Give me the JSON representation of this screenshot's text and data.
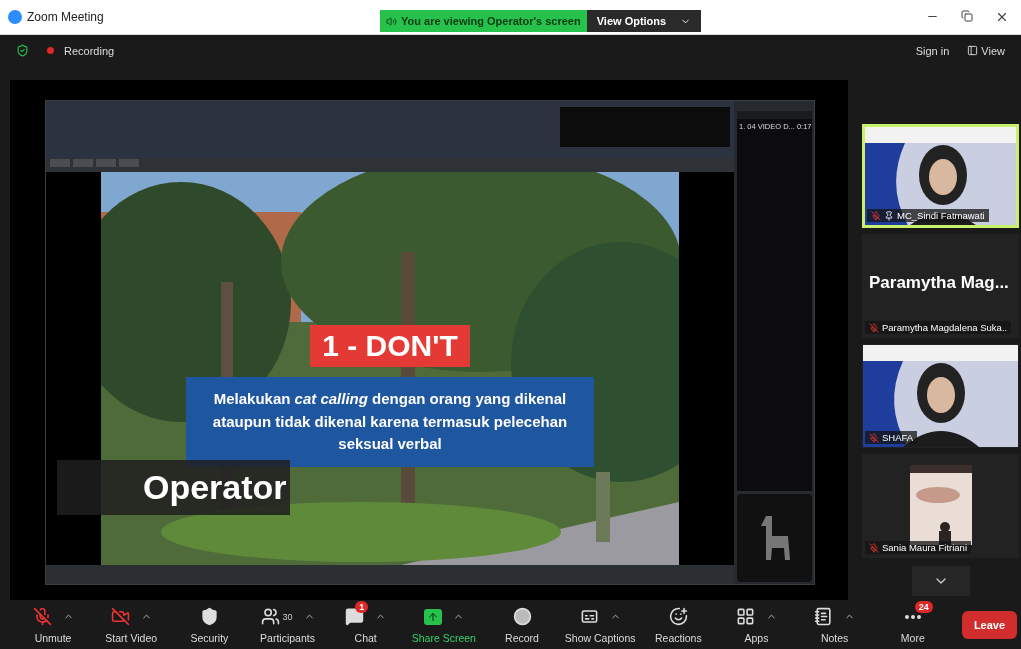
{
  "window": {
    "title": "Zoom Meeting"
  },
  "share_banner": {
    "text": "You are viewing Operator's screen",
    "button": "View Options"
  },
  "meeting_bar": {
    "recording": "Recording",
    "sign_in": "Sign in",
    "view": "View"
  },
  "shared_screen": {
    "playlist_item": "1. 04 VIDEO D... 0:17",
    "heading": "1 - DON'T",
    "body": "Melakukan *cat calling* dengan orang yang dikenal ataupun tidak dikenal karena termasuk pelecehan **seksual verbal**",
    "presenter": "Operator"
  },
  "participants": [
    {
      "kind": "video",
      "name": "MC_Sindi Fatmawati",
      "muted": true,
      "pinned": true,
      "speaking": true
    },
    {
      "kind": "namecard",
      "display_name": "Paramytha  Mag...",
      "name": "Paramytha Magdalena Suka..",
      "muted": true,
      "pinned": false,
      "speaking": false
    },
    {
      "kind": "video",
      "name": "SHAFA",
      "muted": true,
      "pinned": false,
      "speaking": false
    },
    {
      "kind": "small_video",
      "name": "Sania Maura Fitriani",
      "muted": true,
      "pinned": false,
      "speaking": false
    }
  ],
  "toolbar": [
    {
      "kind": "mic",
      "label": "Unmute",
      "caret": true
    },
    {
      "kind": "video",
      "label": "Start Video",
      "caret": true
    },
    {
      "kind": "security",
      "label": "Security",
      "caret": false
    },
    {
      "kind": "participants",
      "label": "Participants",
      "count": "30",
      "caret": true
    },
    {
      "kind": "chat",
      "label": "Chat",
      "badge": "1",
      "caret": true
    },
    {
      "kind": "share",
      "label": "Share Screen",
      "caret": true
    },
    {
      "kind": "record",
      "label": "Record",
      "caret": false
    },
    {
      "kind": "captions",
      "label": "Show Captions",
      "caret": true
    },
    {
      "kind": "reactions",
      "label": "Reactions",
      "caret": false
    },
    {
      "kind": "apps",
      "label": "Apps",
      "caret": true
    },
    {
      "kind": "notes",
      "label": "Notes",
      "caret": true
    },
    {
      "kind": "more",
      "label": "More",
      "badge": "24",
      "caret": false
    }
  ],
  "leave": "Leave"
}
